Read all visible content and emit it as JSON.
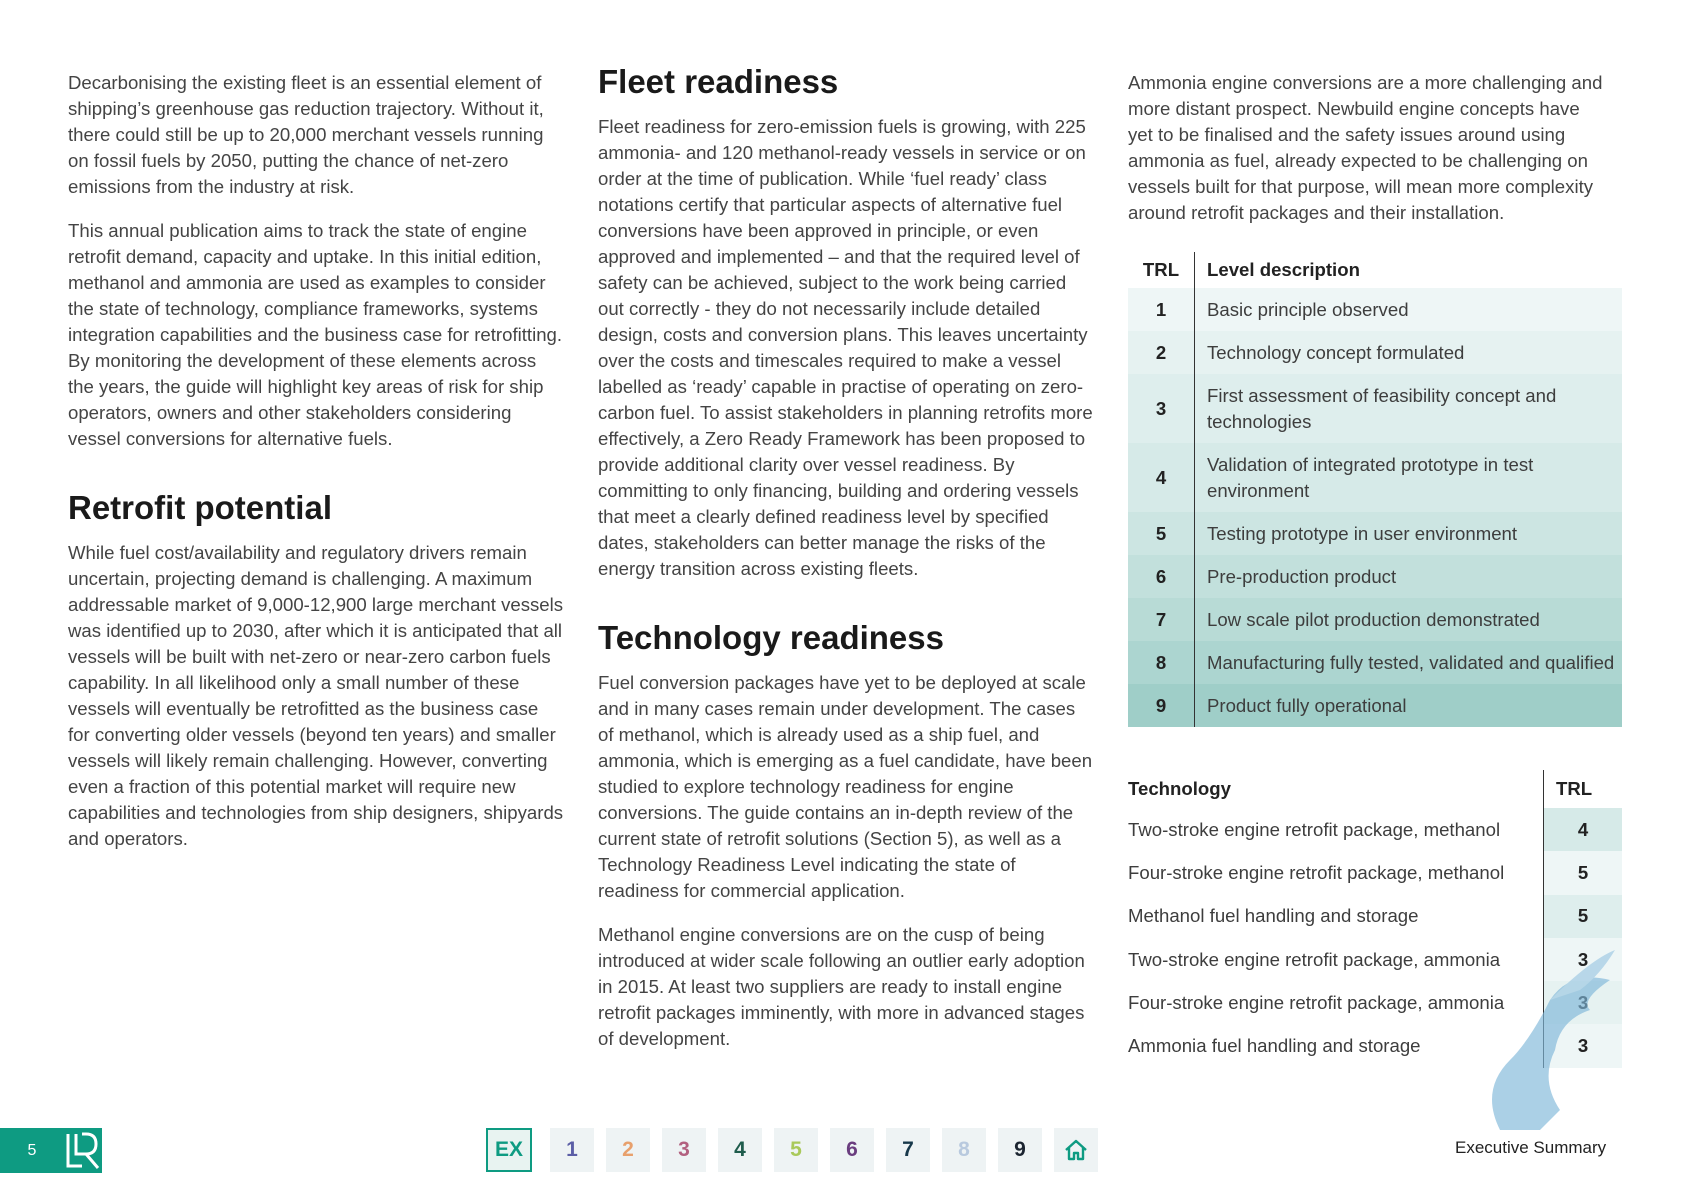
{
  "col1": {
    "p1": "Decarbonising the existing fleet is an essential element of shipping’s greenhouse gas reduction trajectory. Without it, there could still be up to 20,000 merchant vessels running on fossil fuels by 2050, putting the chance of net-zero emissions from the industry at risk.",
    "p2": "This annual publication aims to track the state of engine retrofit demand, capacity and uptake. In this initial edition, methanol and ammonia are used as examples to consider the state of technology, compliance frameworks, systems integration capabilities and the business case for retrofitting. By monitoring the development of these elements across the years, the guide will highlight key areas of risk for ship operators, owners and other stakeholders considering vessel conversions for alternative fuels.",
    "h_retrofit": "Retrofit potential",
    "p3": "While fuel cost/availability and regulatory drivers remain uncertain, projecting demand is challenging. A maximum addressable market of 9,000-12,900 large merchant vessels was identified up to 2030, after which it is anticipated that all vessels will be built with net-zero or near-zero carbon fuels capability. In all likelihood only a small number of these vessels will eventually be retrofitted as the business case for converting older vessels (beyond ten years) and smaller vessels will likely remain challenging. However, converting even a fraction of this potential market will require new capabilities and technologies from ship designers, shipyards and operators."
  },
  "col2": {
    "h_fleet": "Fleet readiness",
    "p1": "Fleet readiness for zero-emission fuels is growing, with 225 ammonia- and 120 methanol-ready vessels in service or on order at the time of publication. While ‘fuel ready’ class notations certify that particular aspects of alternative fuel conversions have been approved in principle, or even approved and implemented – and that the required level of safety can be achieved, subject to the work being carried out correctly - they do not necessarily include detailed design, costs and conversion plans. This leaves uncertainty over the costs and timescales required to make a vessel labelled as ‘ready’ capable in practise of operating on zero-carbon fuel. To assist stakeholders in planning retrofits more effectively, a Zero Ready Framework has been proposed to provide additional clarity over vessel readiness. By committing to only financing, building and ordering vessels that meet a clearly defined readiness level by specified dates, stakeholders can better manage the risks of the energy transition across existing fleets.",
    "h_tech": "Technology readiness",
    "p2": "Fuel conversion packages have yet to be deployed at scale and in many cases remain under development. The cases of methanol, which is already used as a ship fuel, and ammonia, which is emerging as a fuel candidate, have been studied to explore technology readiness for engine conversions. The guide contains an in-depth review of the current state of retrofit solutions (Section 5), as well as a Technology Readiness Level indicating the state of readiness for commercial application.",
    "p3": "Methanol engine conversions are on the cusp of being introduced at wider scale following an outlier early adoption in 2015. At least two suppliers are ready to install engine retrofit packages imminently, with more in advanced stages of development."
  },
  "col3": {
    "p1": "Ammonia engine conversions are a more challenging and more distant prospect. Newbuild engine concepts have yet to be finalised and the safety issues around using ammonia as fuel, already expected to be challenging on vessels built for that purpose, will mean more complexity around retrofit packages and their installation."
  },
  "trl_table": {
    "head_trl": "TRL",
    "head_desc": "Level description",
    "rows": [
      {
        "num": "1",
        "desc": "Basic principle observed",
        "color": "#eef6f6"
      },
      {
        "num": "2",
        "desc": "Technology concept formulated",
        "color": "#e6f2f1"
      },
      {
        "num": "3",
        "desc": "First assessment of feasibility concept and technologies",
        "color": "#deeeed"
      },
      {
        "num": "4",
        "desc": "Validation of integrated prototype in test environment",
        "color": "#d6eae8"
      },
      {
        "num": "5",
        "desc": "Testing prototype in user environment",
        "color": "#cce5e2"
      },
      {
        "num": "6",
        "desc": "Pre-production product",
        "color": "#c2e0dc"
      },
      {
        "num": "7",
        "desc": "Low scale pilot production demonstrated",
        "color": "#b8dbd6"
      },
      {
        "num": "8",
        "desc": "Manufacturing fully tested, validated and qualified",
        "color": "#acd5d0"
      },
      {
        "num": "9",
        "desc": "Product fully operational",
        "color": "#9fcec8"
      }
    ]
  },
  "tech_table": {
    "head_tech": "Technology",
    "head_trl": "TRL",
    "rows": [
      {
        "name": "Two-stroke engine retrofit package, methanol",
        "trl": "4",
        "color": "#d6eae8"
      },
      {
        "name": "Four-stroke engine retrofit package, methanol",
        "trl": "5",
        "color": "#eef6f6"
      },
      {
        "name": "Methanol fuel handling and storage",
        "trl": "5",
        "color": "#deeeed"
      },
      {
        "name": "Two-stroke engine retrofit package, ammonia",
        "trl": "3",
        "color": "#eef6f6"
      },
      {
        "name": "Four-stroke engine retrofit package, ammonia",
        "trl": "3",
        "color": "#e6f2f1"
      },
      {
        "name": "Ammonia fuel handling and storage",
        "trl": "3",
        "color": "#eef6f6"
      }
    ]
  },
  "footer": {
    "page_number": "5",
    "section_label": "Executive Summary",
    "nav": [
      {
        "label": "EX",
        "color": "#0e9b82"
      },
      {
        "label": "1",
        "color": "#5b5ea6"
      },
      {
        "label": "2",
        "color": "#e8a06c"
      },
      {
        "label": "3",
        "color": "#b2607f"
      },
      {
        "label": "4",
        "color": "#1f5c4c"
      },
      {
        "label": "5",
        "color": "#a9c95a"
      },
      {
        "label": "6",
        "color": "#6a3d7f"
      },
      {
        "label": "7",
        "color": "#17384a"
      },
      {
        "label": "8",
        "color": "#b8c9de"
      },
      {
        "label": "9",
        "color": "#1b2430"
      }
    ],
    "home_icon": "home-icon",
    "logo_icon": "lr-logo-icon",
    "accent": "#0e9b82"
  }
}
